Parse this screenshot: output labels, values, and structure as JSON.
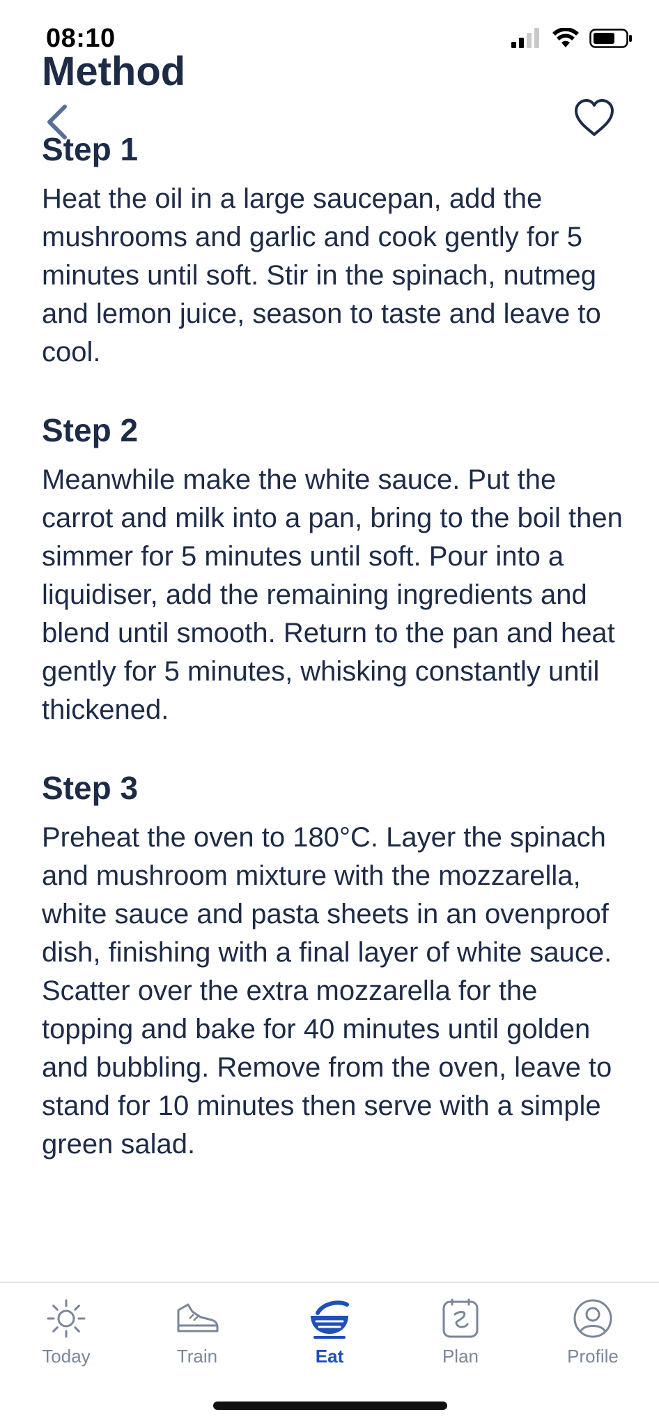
{
  "status_bar": {
    "time": "08:10"
  },
  "header": {
    "title": "Method"
  },
  "steps": [
    {
      "heading": "Step 1",
      "text": "Heat the oil in a large saucepan, add the mushrooms and garlic and cook gently for 5 minutes until soft. Stir in the spinach, nutmeg and lemon juice, season to taste and leave to cool."
    },
    {
      "heading": "Step 2",
      "text": "Meanwhile make the white sauce. Put the carrot and milk into a pan, bring to the boil then simmer for 5 minutes until soft. Pour into a liquidiser, add the remaining ingredients and blend until smooth. Return to the pan and heat gently for 5 minutes, whisking constantly until thickened."
    },
    {
      "heading": "Step 3",
      "text": "Preheat the oven to 180°C. Layer the spinach and mushroom mixture with the mozzarella, white sauce and pasta sheets in an ovenproof dish, finishing with a final layer of white sauce. Scatter over the extra mozzarella for the topping and bake for 40 minutes until golden and bubbling. Remove from the oven, leave to stand for 10 minutes then serve with a simple green salad."
    }
  ],
  "tabs": [
    {
      "label": "Today",
      "icon": "sun-icon",
      "active": false
    },
    {
      "label": "Train",
      "icon": "shoe-icon",
      "active": false
    },
    {
      "label": "Eat",
      "icon": "bowl-icon",
      "active": true
    },
    {
      "label": "Plan",
      "icon": "clipboard-icon",
      "active": false
    },
    {
      "label": "Profile",
      "icon": "profile-icon",
      "active": false
    }
  ],
  "colors": {
    "text": "#1d2b47",
    "accent": "#1f4fb7",
    "inactive": "#7a8699",
    "back_arrow": "#5a6f96"
  }
}
